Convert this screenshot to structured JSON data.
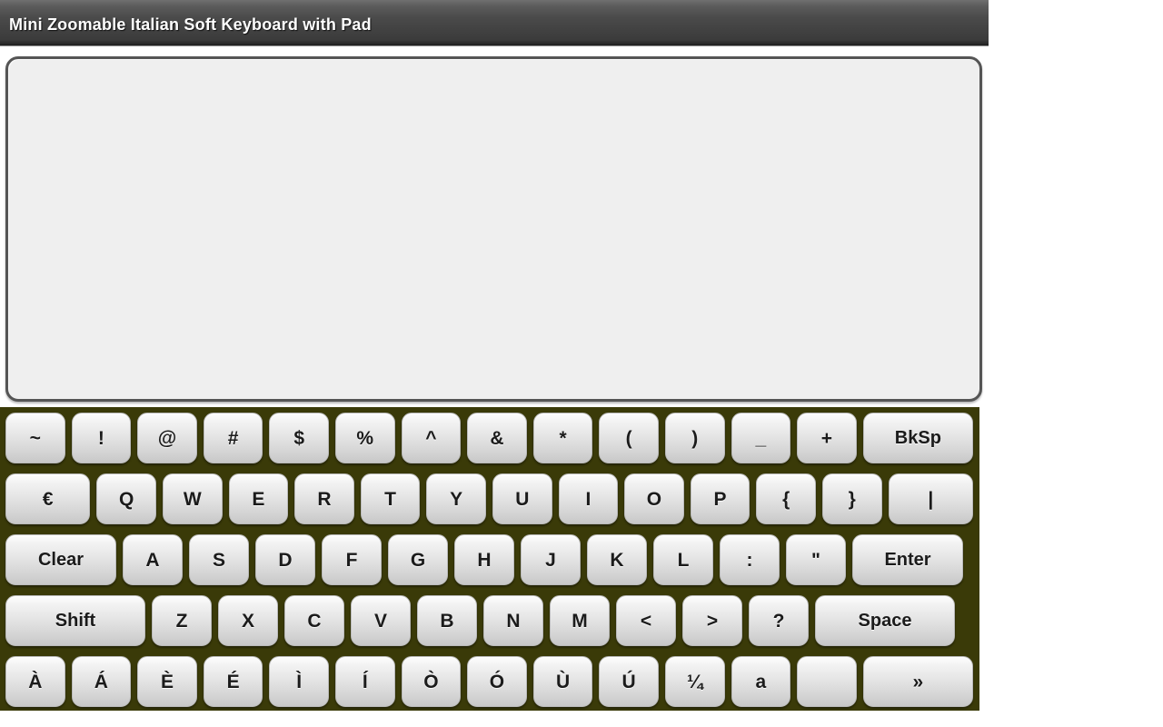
{
  "window": {
    "title": "Mini Zoomable Italian Soft Keyboard with Pad"
  },
  "colors": {
    "titlebar_dark": "#2a2a2a",
    "titlebar_light": "#6f6f6f",
    "keyboard_background": "#3a3a08",
    "key_face_top": "#fdfdfd",
    "key_face_bottom": "#c8c8c8",
    "key_text": "#1b1b1b",
    "pad_background": "#efefef",
    "pad_border": "#555555"
  },
  "pad": {
    "value": "",
    "placeholder": ""
  },
  "keyboard": {
    "layout_name": "Italian",
    "rows": [
      {
        "name": "symbols-row",
        "keys": [
          {
            "label": "~",
            "name": "key-tilde",
            "width": "w1"
          },
          {
            "label": "!",
            "name": "key-exclamation",
            "width": "w1"
          },
          {
            "label": "@",
            "name": "key-at",
            "width": "w1"
          },
          {
            "label": "#",
            "name": "key-hash",
            "width": "w1"
          },
          {
            "label": "$",
            "name": "key-dollar",
            "width": "w1"
          },
          {
            "label": "%",
            "name": "key-percent",
            "width": "w1"
          },
          {
            "label": "^",
            "name": "key-caret",
            "width": "w1"
          },
          {
            "label": "&",
            "name": "key-ampersand",
            "width": "w1"
          },
          {
            "label": "*",
            "name": "key-asterisk",
            "width": "w1"
          },
          {
            "label": "(",
            "name": "key-paren-open",
            "width": "w1"
          },
          {
            "label": ")",
            "name": "key-paren-close",
            "width": "w1"
          },
          {
            "label": "_",
            "name": "key-underscore",
            "width": "w1"
          },
          {
            "label": "+",
            "name": "key-plus",
            "width": "w1"
          },
          {
            "label": "BkSp",
            "name": "key-backspace",
            "width": "w3"
          }
        ]
      },
      {
        "name": "qwerty-row",
        "keys": [
          {
            "label": "€",
            "name": "key-euro",
            "width": "w2"
          },
          {
            "label": "Q",
            "name": "key-q",
            "width": "w1"
          },
          {
            "label": "W",
            "name": "key-w",
            "width": "w1"
          },
          {
            "label": "E",
            "name": "key-e",
            "width": "w1"
          },
          {
            "label": "R",
            "name": "key-r",
            "width": "w1"
          },
          {
            "label": "T",
            "name": "key-t",
            "width": "w1"
          },
          {
            "label": "Y",
            "name": "key-y",
            "width": "w1"
          },
          {
            "label": "U",
            "name": "key-u",
            "width": "w1"
          },
          {
            "label": "I",
            "name": "key-i",
            "width": "w1"
          },
          {
            "label": "O",
            "name": "key-o",
            "width": "w1"
          },
          {
            "label": "P",
            "name": "key-p",
            "width": "w1"
          },
          {
            "label": "{",
            "name": "key-brace-open",
            "width": "w1"
          },
          {
            "label": "}",
            "name": "key-brace-close",
            "width": "w1"
          },
          {
            "label": "|",
            "name": "key-pipe",
            "width": "w2"
          }
        ]
      },
      {
        "name": "home-row",
        "keys": [
          {
            "label": "Clear",
            "name": "key-clear",
            "width": "w3"
          },
          {
            "label": "A",
            "name": "key-a",
            "width": "w1"
          },
          {
            "label": "S",
            "name": "key-s",
            "width": "w1"
          },
          {
            "label": "D",
            "name": "key-d",
            "width": "w1"
          },
          {
            "label": "F",
            "name": "key-f",
            "width": "w1"
          },
          {
            "label": "G",
            "name": "key-g",
            "width": "w1"
          },
          {
            "label": "H",
            "name": "key-h",
            "width": "w1"
          },
          {
            "label": "J",
            "name": "key-j",
            "width": "w1"
          },
          {
            "label": "K",
            "name": "key-k",
            "width": "w1"
          },
          {
            "label": "L",
            "name": "key-l",
            "width": "w1"
          },
          {
            "label": ":",
            "name": "key-colon",
            "width": "w1"
          },
          {
            "label": "\"",
            "name": "key-quote",
            "width": "w1"
          },
          {
            "label": "Enter",
            "name": "key-enter",
            "width": "w3"
          }
        ]
      },
      {
        "name": "shift-row",
        "keys": [
          {
            "label": "Shift",
            "name": "key-shift",
            "width": "w4"
          },
          {
            "label": "Z",
            "name": "key-z",
            "width": "w1"
          },
          {
            "label": "X",
            "name": "key-x",
            "width": "w1"
          },
          {
            "label": "C",
            "name": "key-c",
            "width": "w1"
          },
          {
            "label": "V",
            "name": "key-v",
            "width": "w1"
          },
          {
            "label": "B",
            "name": "key-b",
            "width": "w1"
          },
          {
            "label": "N",
            "name": "key-n",
            "width": "w1"
          },
          {
            "label": "M",
            "name": "key-m",
            "width": "w1"
          },
          {
            "label": "<",
            "name": "key-less-than",
            "width": "w1"
          },
          {
            "label": ">",
            "name": "key-greater-than",
            "width": "w1"
          },
          {
            "label": "?",
            "name": "key-question",
            "width": "w1"
          },
          {
            "label": "Space",
            "name": "key-space",
            "width": "w4"
          }
        ]
      },
      {
        "name": "accents-row",
        "keys": [
          {
            "label": "À",
            "name": "key-a-grave",
            "width": "w1"
          },
          {
            "label": "Á",
            "name": "key-a-acute",
            "width": "w1"
          },
          {
            "label": "È",
            "name": "key-e-grave",
            "width": "w1"
          },
          {
            "label": "É",
            "name": "key-e-acute",
            "width": "w1"
          },
          {
            "label": "Ì",
            "name": "key-i-grave",
            "width": "w1"
          },
          {
            "label": "Í",
            "name": "key-i-acute",
            "width": "w1"
          },
          {
            "label": "Ò",
            "name": "key-o-grave",
            "width": "w1"
          },
          {
            "label": "Ó",
            "name": "key-o-acute",
            "width": "w1"
          },
          {
            "label": "Ù",
            "name": "key-u-grave",
            "width": "w1"
          },
          {
            "label": "Ú",
            "name": "key-u-acute",
            "width": "w1"
          },
          {
            "label": "¼",
            "name": "key-one-quarter",
            "width": "w1"
          },
          {
            "label": "a",
            "name": "key-lowercase-a",
            "width": "w1"
          },
          {
            "label": "",
            "name": "key-blank",
            "width": "w1"
          },
          {
            "label": "»",
            "name": "key-next-page",
            "width": "w3"
          }
        ]
      }
    ]
  }
}
